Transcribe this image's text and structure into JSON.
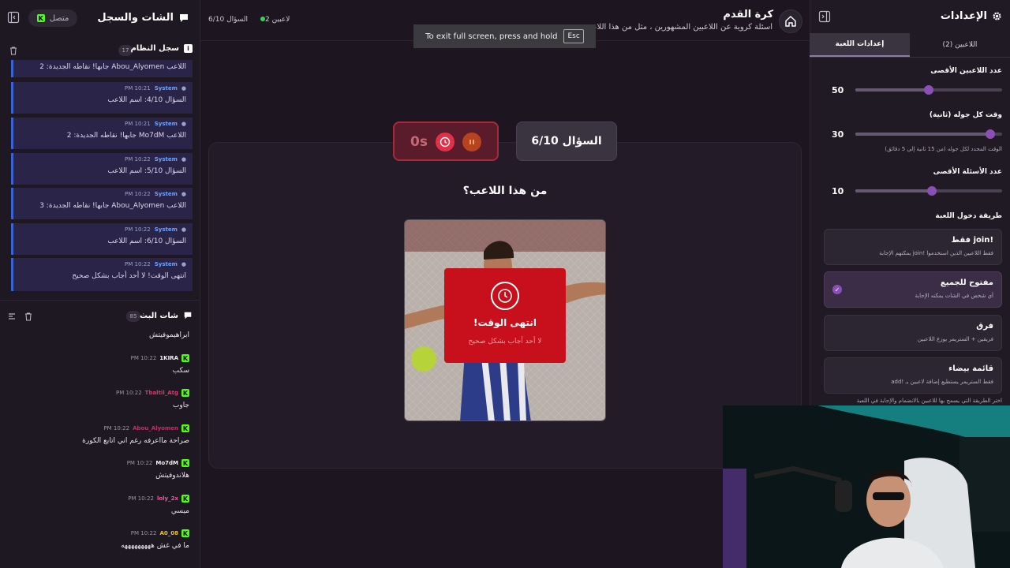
{
  "left_panel": {
    "title": "الشات والسجل",
    "connection_status": "متصل",
    "system_log": {
      "title": "سجل النظام",
      "count": "17",
      "partial_first": "اللاعب Abou_Alyomen جابها! نقاطه الجديدة: 2",
      "messages": [
        {
          "name": "System",
          "time": "10:21 PM",
          "text": "السؤال 4/10: اسم اللاعب"
        },
        {
          "name": "System",
          "time": "10:21 PM",
          "text": "اللاعب Mo7dM جابها! نقاطه الجديدة: 2"
        },
        {
          "name": "System",
          "time": "10:22 PM",
          "text": "السؤال 5/10: اسم اللاعب"
        },
        {
          "name": "System",
          "time": "10:22 PM",
          "text": "اللاعب Abou_Alyomen جابها! نقاطه الجديدة: 3"
        },
        {
          "name": "System",
          "time": "10:22 PM",
          "text": "السؤال 6/10: اسم اللاعب"
        },
        {
          "name": "System",
          "time": "10:22 PM",
          "text": "انتهى الوقت! لا أحد أجاب بشكل صحيح"
        }
      ]
    },
    "stream_chat": {
      "title": "شات البث",
      "count": "85",
      "partial_first": "ابراهيموفيتش",
      "messages": [
        {
          "name": "1KIRA",
          "time": "10:22 PM",
          "text": "سكب",
          "color": "#f2f2f2"
        },
        {
          "name": "Tbaltil_Atg",
          "time": "10:22 PM",
          "text": "جاوب",
          "color": "#d43a6a"
        },
        {
          "name": "Abou_Alyomen",
          "time": "10:22 PM",
          "text": "صراحة مااعرفه رغم اني اتابع الكورة",
          "color": "#c0306a"
        },
        {
          "name": "Mo7dM",
          "time": "10:22 PM",
          "text": "هلاندوفيتش",
          "color": "#f2f2f2"
        },
        {
          "name": "loly_2x",
          "time": "10:22 PM",
          "text": "ميسي",
          "color": "#e85aa0"
        },
        {
          "name": "A0_08",
          "time": "10:22 PM",
          "text": "ما في غش هههههههههه",
          "color": "#f0c419"
        }
      ]
    }
  },
  "top_bar": {
    "game_title": "كرة القدم",
    "game_desc": "أسئلة كروية عن اللاعبين المشهورين ، مثل من هذا اللاعب !",
    "players_status": "2 لاعبين",
    "question_status": "السؤال 6/10"
  },
  "toast": {
    "text": "To exit full screen, press and hold",
    "key": "Esc"
  },
  "game": {
    "timer": "0s",
    "question_counter": "السؤال 6/10",
    "question": "من هذا اللاعب؟",
    "timeup_title": "انتهى الوقت!",
    "timeup_sub": "لا أحد أجاب بشكل صحيح"
  },
  "settings": {
    "title": "الإعدادات",
    "tabs": [
      "اللاعبين (2)",
      "إعدادات اللعبة"
    ],
    "max_players_label": "عدد اللاعبين الأقصى",
    "max_players": "50",
    "max_players_fraction": 0.5,
    "round_time_label": "وقت كل جوله (ثانية)",
    "round_time": "30",
    "round_time_fraction": 0.92,
    "round_time_hint": "الوقت المحدد لكل جوله (من 15 ثانية إلى 5 دقائق)",
    "max_questions_label": "عدد الأسئلة الأقصى",
    "max_questions": "10",
    "max_questions_fraction": 0.52,
    "entry_method_label": "طريقة دخول اللعبة",
    "modes": [
      {
        "title": "!join فقط",
        "desc": "فقط اللاعبين الذين استخدموا !join يمكنهم الإجابة",
        "active": false
      },
      {
        "title": "مفتوح للجميع",
        "desc": "أي شخص في الشات يمكنه الإجابة",
        "active": true
      },
      {
        "title": "فرق",
        "desc": "فريقين + الستريمر يوزع اللاعبين",
        "active": false
      },
      {
        "title": "قائمة بيضاء",
        "desc": "فقط الستريمر يستطيع إضافة لاعبين بـ !add",
        "active": false
      }
    ],
    "entry_hint": "اختر الطريقة التي يسمح بها للاعبين بالانضمام والإجابة في اللعبة"
  },
  "colors": {
    "accent": "#8b4fb5",
    "system_border": "#3b63d8",
    "timeup_red": "#c8101c",
    "kick_green": "#53fc18"
  }
}
